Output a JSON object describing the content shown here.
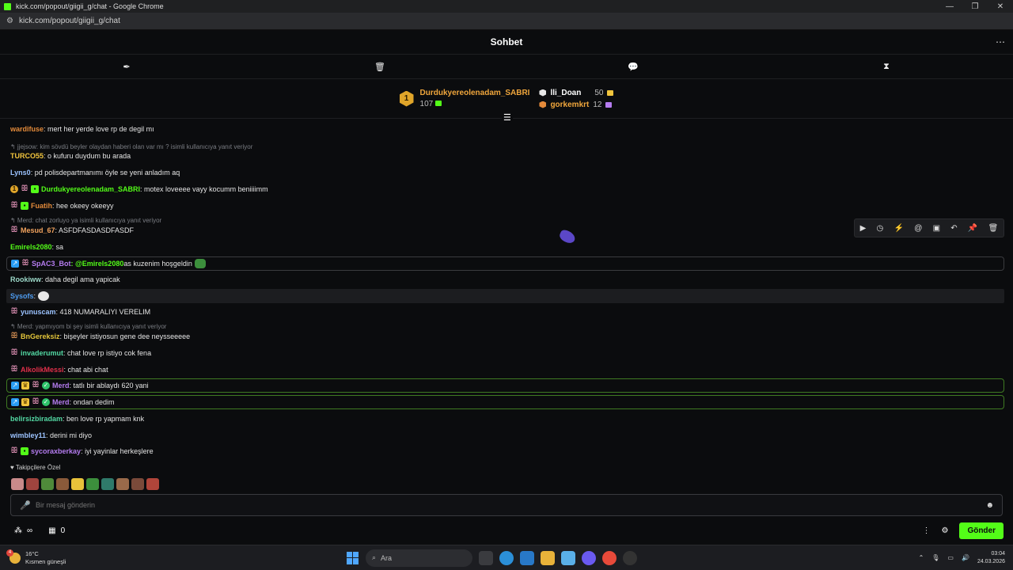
{
  "browser": {
    "window_title": "kick.com/popout/giigii_g/chat - Google Chrome",
    "url": "kick.com/popout/giigii_g/chat",
    "controls": {
      "minimize": "—",
      "restore": "❐",
      "close": "✕"
    }
  },
  "chat_header": {
    "title": "Sohbet",
    "more_icon": "⋯"
  },
  "toolbar": {
    "icons": [
      "pin-icon",
      "trash-icon",
      "chat-bubble-icon",
      "hourglass-icon"
    ],
    "glyphs": [
      "✒",
      "🗑",
      "💬",
      "⧗"
    ]
  },
  "leaderboard": {
    "first": {
      "rank": "1",
      "name": "Durdukyereolenadam_SABRI",
      "count": "107"
    },
    "second": {
      "name": "lli_Doan",
      "count": "50"
    },
    "third": {
      "name": "gorkemkrt",
      "count": "12"
    }
  },
  "messages": [
    {
      "user": "wardifuse",
      "color": "#e38a3a",
      "text": ": mert her yerde love rp de degil mı"
    },
    {
      "reply": "↰ jjejsow: kim sövdü beyler olaydan haberi olan var mı ? isimli kullanıcıya yanıt veriyor",
      "user": "TURCO55",
      "color": "#f2c53d",
      "text": ": o kufuru duydum bu arada"
    },
    {
      "user": "Lyns0",
      "color": "#9cc3ff",
      "text": ": pd polisdepartmanımı öyle se yeni anladım aq"
    },
    {
      "user": "Durdukyereolenadam_SABRI",
      "color": "#53fc18",
      "text": ": motex loveeee vayy kocumm beniiiimm"
    },
    {
      "user": "Fuatih",
      "color": "#e38a3a",
      "text": ": hee okeey okeeyy"
    },
    {
      "reply": "↰ Merd: chat zorluyo ya isimli kullanıcıya yanıt veriyor",
      "user": "Mesud_67",
      "color": "#f2a35e",
      "text": ": ASFDFASDASDFASDF"
    },
    {
      "user": "Emirels2080",
      "color": "#53fc18",
      "text": ": sa"
    },
    {
      "user": "SpAC3_Bot",
      "color": "#b57cf0",
      "text": " as kuzenim hoşgeldin",
      "mention": ": @Emirels2080"
    },
    {
      "user": "Rookiww",
      "color": "#9cd8c8",
      "text": ": daha degil ama yapicak"
    },
    {
      "user": "Sysofs",
      "color": "#4e9cf0",
      "text": ":"
    },
    {
      "user": "yunuscam",
      "color": "#9cc3ff",
      "text": ": 418 NUMARALIYI VERELIM"
    },
    {
      "reply": "↰ Merd: yapmıyom bi şey isimli kullanıcıya yanıt veriyor",
      "user": "BnGereksiz",
      "color": "#e3c53a",
      "text": ": bişeyler istiyosun gene dee neysseeeee"
    },
    {
      "user": "invaderumut",
      "color": "#53d8a3",
      "text": ": chat love rp istiyo cok fena"
    },
    {
      "user": "AlkolikMessi",
      "color": "#e0304a",
      "text": ": chat abi chat"
    },
    {
      "user": "Merd",
      "color": "#b57cf0",
      "text": ": tatlı bir ablaydı 620 yani"
    },
    {
      "user": "Merd",
      "color": "#b57cf0",
      "text": ": ondan dedim"
    },
    {
      "user": "belirsizbiradam",
      "color": "#53d8a3",
      "text": ": ben love rp yapmam knk"
    },
    {
      "user": "wimbley11",
      "color": "#9cc3ff",
      "text": ": derini mi diyo"
    },
    {
      "user": "sycoraxberkay",
      "color": "#b57cf0",
      "text": ": iyi yayinlar herkeşlere"
    }
  ],
  "message_actions": [
    "▶",
    "◷",
    "⚡",
    "@",
    "▣",
    "↶",
    "📌",
    "🗑"
  ],
  "follower_emotes": {
    "label": "Takipçilere Özel",
    "icon": "♥"
  },
  "input": {
    "placeholder": "Bir mesaj gönderin",
    "mic_icon": "🎤",
    "emoji_icon": "☻"
  },
  "bottom": {
    "infinity": "∞",
    "count": "0",
    "send": "Gönder",
    "more": "⋮",
    "gear": "⚙"
  },
  "taskbar": {
    "temp": "16°C",
    "weather": "Kısmen güneşli",
    "weather_badge": "4",
    "search": "Ara",
    "time": "03:04",
    "date": "24.03.2026"
  }
}
